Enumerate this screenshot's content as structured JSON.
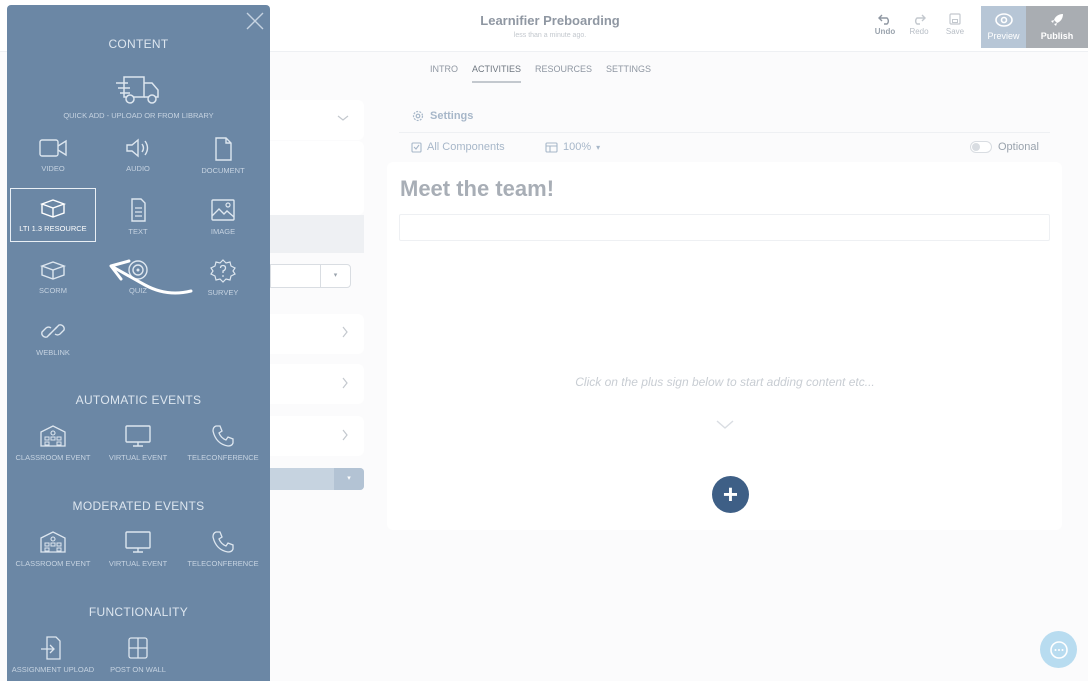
{
  "header": {
    "title": "Learnifier Preboarding",
    "subtitle": "less than a minute ago.",
    "undo_label": "Undo",
    "redo_label": "Redo",
    "save_label": "Save",
    "preview_label": "Preview",
    "publish_label": "Publish"
  },
  "tabs": [
    {
      "label": "INTRO",
      "active": false
    },
    {
      "label": "ACTIVITIES",
      "active": true
    },
    {
      "label": "RESOURCES",
      "active": false
    },
    {
      "label": "SETTINGS",
      "active": false
    }
  ],
  "editor": {
    "settings_label": "Settings",
    "components_label": "All Components",
    "zoom_label": "100%",
    "optional_label": "Optional",
    "title": "Meet the team!",
    "hint": "Click on the plus sign below to start adding content etc...",
    "add_label": "+"
  },
  "content_panel": {
    "content_title": "CONTENT",
    "quick_add_label": "QUICK ADD - UPLOAD OR FROM LIBRARY",
    "content_items": {
      "video": "VIDEO",
      "audio": "AUDIO",
      "document": "DOCUMENT",
      "lti": "LTI 1.3 RESOURCE",
      "text": "TEXT",
      "image": "IMAGE",
      "scorm": "SCORM",
      "quiz": "QUIZ",
      "survey": "SURVEY",
      "weblink": "WEBLINK"
    },
    "automatic_title": "AUTOMATIC EVENTS",
    "automatic_items": {
      "classroom": "CLASSROOM EVENT",
      "virtual": "VIRTUAL EVENT",
      "teleconference": "TELECONFERENCE"
    },
    "moderated_title": "MODERATED EVENTS",
    "moderated_items": {
      "classroom": "CLASSROOM EVENT",
      "virtual": "VIRTUAL EVENT",
      "teleconference": "TELECONFERENCE"
    },
    "functionality_title": "FUNCTIONALITY",
    "functionality_items": {
      "assignment": "ASSIGNMENT UPLOAD",
      "wall": "POST ON WALL"
    },
    "highlighted_item": "LTI 1.3 RESOURCE"
  },
  "colors": {
    "panel": "#6b87a5",
    "accent": "#3e5f86",
    "preview": "#b7c6d6",
    "publish": "#a9adb2"
  }
}
